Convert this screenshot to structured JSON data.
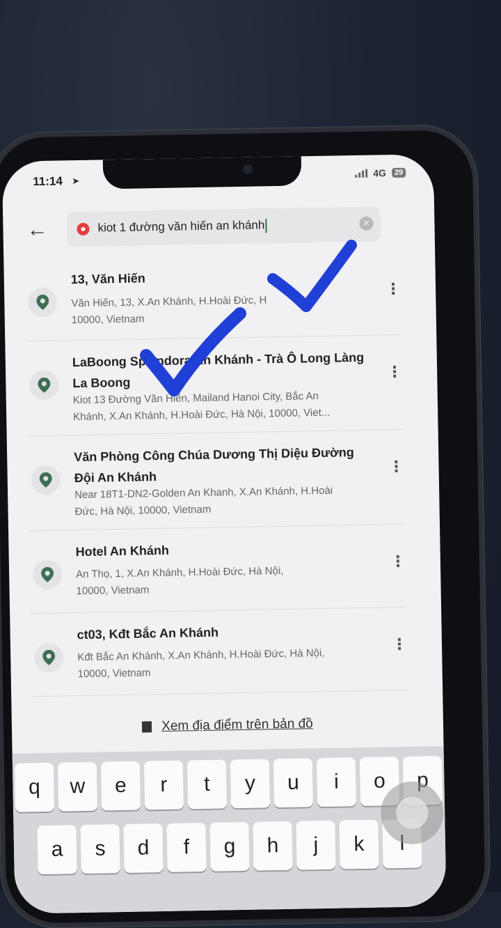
{
  "status_bar": {
    "time": "11:14",
    "network": "4G",
    "battery": "29"
  },
  "search": {
    "query": "kiot 1 đường văn hiến an khánh"
  },
  "results": [
    {
      "title": "13, Văn Hiến",
      "address_line1": "Văn Hiến, 13, X.An Khánh, H.Hoài Đức, H",
      "address_line2": "10000, Vietnam"
    },
    {
      "title": "LaBoong Splendora An Khánh - Trà Ô Long Làng La Boong",
      "address_line1": "Kiot 13 Đường Văn Hiến, Mailand Hanoi City, Bắc An",
      "address_line2": "Khánh, X.An Khánh, H.Hoài Đức, Hà Nội, 10000, Viet..."
    },
    {
      "title": "Văn Phòng Công Chúa Dương Thị Diệu Đường Đội An Khánh",
      "address_line1": "Near 18T1-DN2-Golden An Khanh, X.An Khánh, H.Hoài",
      "address_line2": "Đức, Hà Nội, 10000, Vietnam"
    },
    {
      "title": "Hotel An Khánh",
      "address_line1": "An Thọ, 1, X.An Khánh, H.Hoài Đức, Hà Nội,",
      "address_line2": "10000, Vietnam"
    },
    {
      "title": "ct03, Kđt Bắc An Khánh",
      "address_line1": "Kđt Bắc An Khánh, X.An Khánh, H.Hoài Đức, Hà Nội,",
      "address_line2": "10000, Vietnam"
    }
  ],
  "map_link": "Xem địa điểm trên bản đồ",
  "keyboard": {
    "row1": [
      "q",
      "w",
      "e",
      "r",
      "t",
      "y",
      "u",
      "i",
      "o",
      "p"
    ],
    "row2": [
      "a",
      "s",
      "d",
      "f",
      "g",
      "h",
      "j",
      "k",
      "l"
    ]
  },
  "colors": {
    "checkmark": "#1f3fd6",
    "pin": "#3f6e55",
    "clear_dot": "#e53e3e"
  }
}
